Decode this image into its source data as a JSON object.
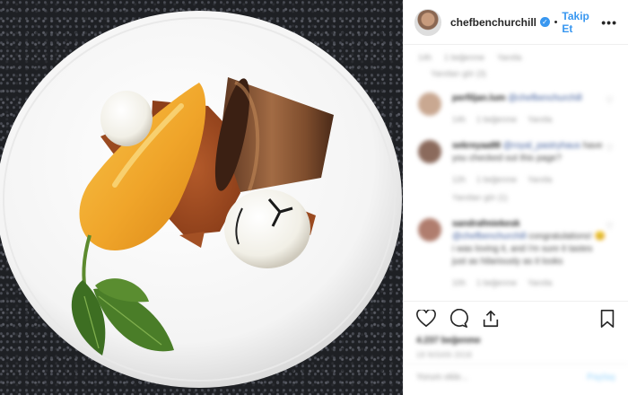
{
  "post": {
    "image_alt": "Plated dessert: orange pear, chocolate flowerpot, crumble, white chocolate spheres and mint on a white plate"
  },
  "header": {
    "username": "chefbenchurchill",
    "separator": "•",
    "follow_label": "Takip Et",
    "more_label": "•••",
    "verified_color": "#3897f0",
    "follow_color": "#3897f0"
  },
  "comments": {
    "top_meta": [
      "14h",
      "1 beğenme",
      "Yanıtla"
    ],
    "top_meta2": [
      "Yanıtları gör (3)"
    ],
    "items": [
      {
        "name": "perfiljan.lum",
        "mention": "@chefbenchurchill",
        "text": "",
        "meta": [
          "14h",
          "1 beğenme",
          "Yanıtla"
        ],
        "avatar_color": "#c9a891"
      },
      {
        "name": "sekreyaa88",
        "mention": "@royal_pastryhaus",
        "text": "have you checked out this page?",
        "meta": [
          "12h",
          "1 beğenme",
          "Yanıtla"
        ],
        "meta2": [
          "Yanıtları gör (1)"
        ],
        "avatar_color": "#8b6a5c"
      },
      {
        "name": "sandrafmiekesk",
        "mention": "@chefbenchurchill",
        "text": "congratulations! 😊 i was loving it, and i'm sure it tastes just as hilariously as it looks",
        "meta": [
          "10h",
          "1 beğenme",
          "Yanıtla"
        ],
        "avatar_color": "#b07d6e"
      }
    ]
  },
  "actions": {
    "like_icon": "heart-icon",
    "comment_icon": "comment-icon",
    "share_icon": "share-icon",
    "save_icon": "bookmark-icon",
    "likes": "4.237 beğenme",
    "date": "18 Nisan 2018",
    "add_comment_placeholder": "Yorum ekle...",
    "post_label": "Paylaş"
  }
}
